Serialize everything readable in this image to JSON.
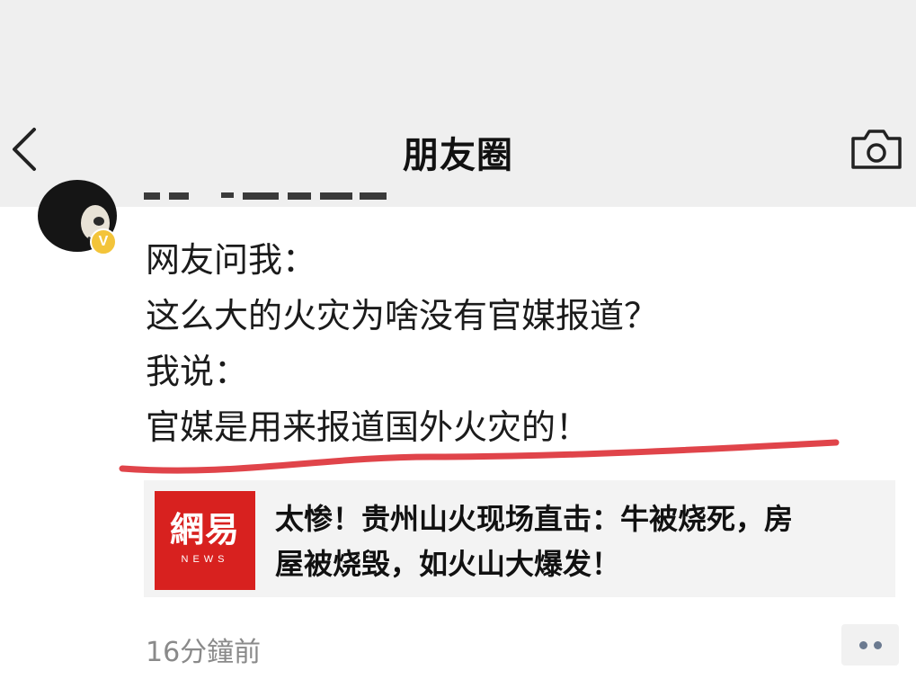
{
  "navbar": {
    "title": "朋友圈",
    "back_icon": "chevron-left-icon",
    "camera_icon": "camera-icon"
  },
  "post": {
    "verified_badge": "V",
    "lines": [
      "网友问我：",
      "这么大的火灾为啥没有官媒报道？",
      "我说：",
      "官媒是用来报道国外火灾的！"
    ],
    "underline_color": "#e0444a"
  },
  "link_card": {
    "logo_main": "網易",
    "logo_sub": "NEWS",
    "logo_color": "#d8211f",
    "title_line1": "太惨！贵州山火现场直击：牛被烧死，房",
    "title_line2": "屋被烧毁，如火山大爆发！"
  },
  "footer": {
    "timestamp": "16分鐘前",
    "more_icon": "more-dots-icon"
  }
}
